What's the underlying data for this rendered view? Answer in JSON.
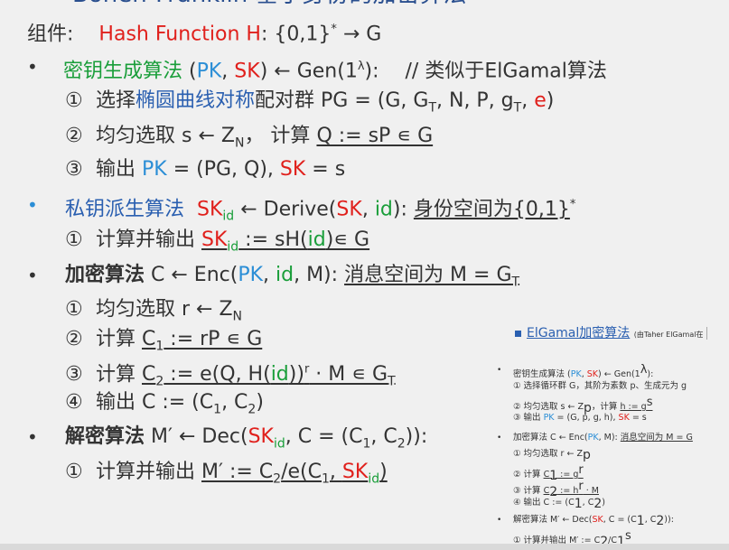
{
  "title_partial": "Boneh-Franklin 基于身份的加密算法",
  "components": {
    "label": "组件:",
    "hash": "Hash Function H",
    "rest": ": {0,1}",
    "star": "*",
    "arrow": " → G"
  },
  "keygen": {
    "name": "密钥生成算法",
    "pre": " (",
    "pk": "PK",
    "comma": ", ",
    "sk": "SK",
    "mid": ") ← Gen(1",
    "lambda": "λ",
    "post": "):",
    "comment": "// 类似于ElGamal算法",
    "s1_num": "①",
    "s1_a": "选择",
    "s1_b": "椭圆曲线对称",
    "s1_c": "配对群 PG = (G, G",
    "s1_t1": "T",
    "s1_d": ", N, P, g",
    "s1_t2": "T",
    "s1_e": ", ",
    "s1_ee": "e",
    "s1_f": ")",
    "s2_num": "②",
    "s2_a": "均匀选取 s ← Z",
    "s2_n": "N",
    "s2_b": "， 计算 ",
    "s2_c": "Q := sP ∊ G",
    "s3_num": "③",
    "s3_a": "输出 ",
    "s3_pk": "PK",
    "s3_b": " = (PG, Q), ",
    "s3_sk": "SK",
    "s3_c": " = s"
  },
  "derive": {
    "name": "私钥派生算法",
    "sk": "SK",
    "id": "id",
    "mid": " ← Derive(",
    "sk2": "SK",
    "comma": ", ",
    "id2": "id",
    "post": "):",
    "space": "身份空间为{0,1}",
    "star": "*",
    "s1_num": "①",
    "s1_a": "计算并输出 ",
    "s1_sk": "SK",
    "s1_id": "id",
    "s1_b": " := sH(",
    "s1_id2": "id",
    "s1_c": ")∊ G"
  },
  "enc": {
    "name": "加密算法",
    "pre": " C ← Enc(",
    "pk": "PK",
    "comma": ", ",
    "id": "id",
    "post": ", M):",
    "space": "消息空间为 M = G",
    "t": "T",
    "s1_num": "①",
    "s1_a": "均匀选取 r ← Z",
    "s1_n": "N",
    "s2_num": "②",
    "s2_a": "计算 ",
    "s2_c": "C",
    "s2_1": "1",
    "s2_b": " := rP ∊ G",
    "s3_num": "③",
    "s3_a": "计算 ",
    "s3_c": "C",
    "s3_2": "2",
    "s3_b": " := e(Q, H(",
    "s3_id": "id",
    "s3_d": "))",
    "s3_r": "r",
    "s3_e": " · M   ∊ G",
    "s3_t": "T",
    "s4_num": "④",
    "s4_a": "输出 C := (C",
    "s4_1": "1",
    "s4_b": ", C",
    "s4_2": "2",
    "s4_c": ")"
  },
  "dec": {
    "name": "解密算法",
    "pre": " M′ ← Dec(",
    "sk": "SK",
    "id": "id",
    "post": ", C = (C",
    "c1": "1",
    "mid": ", C",
    "c2": "2",
    "end": ")):",
    "s1_num": "①",
    "s1_a": "计算并输出 ",
    "s1_b": "M′ := C",
    "s1_2": "2",
    "s1_c": "/e(C",
    "s1_1": "1",
    "s1_d": ", ",
    "s1_sk": "SK",
    "s1_id": "id",
    "s1_e": ")"
  },
  "inset": {
    "title": "ElGamal加密算法",
    "note": "(由Taher ElGamal在",
    "kg": "密钥生成算法",
    "kg_pre": " (",
    "kg_pk": "PK",
    "kg_c": ", ",
    "kg_sk": "SK",
    "kg_post": ") ← Gen(1",
    "kg_l": "λ",
    "kg_end": "):",
    "kg1": "① 选择循环群 G，其阶为素数 p、生成元为 g",
    "kg2a": "② 均匀选取 s ← Z",
    "kg2p": "p",
    "kg2b": "，计算 ",
    "kg2c": "h := g",
    "kg2s": "s",
    "kg3a": "③ 输出 ",
    "kg3pk": "PK",
    "kg3b": " = (G, p, g, h), ",
    "kg3sk": "SK",
    "kg3c": " = s",
    "enc": "加密算法",
    "enc_pre": " C ← Enc(",
    "enc_pk": "PK",
    "enc_post": ", M):",
    "enc_space": "消息空间为 M = G",
    "e1a": "① 均匀选取 r ← Z",
    "e1p": "p",
    "e2a": "② 计算 ",
    "e2b": "C",
    "e2c": "1",
    "e2d": " := g",
    "e2e": "r",
    "e3a": "③ 计算 ",
    "e3b": "C",
    "e3c": "2",
    "e3d": " := h",
    "e3e": "r",
    "e3f": " · M",
    "e4a": "④ 输出 C := (C",
    "e4b": "1",
    "e4c": ", C",
    "e4d": "2",
    "e4e": ")",
    "dec": "解密算法",
    "dec_pre": " M′ ← Dec(",
    "dec_sk": "SK",
    "dec_post": ", C = (C",
    "dec_1": "1",
    "dec_m": ", C",
    "dec_2": "2",
    "dec_end": ")):",
    "d1a": "① 计算并输出 ",
    "d1b": "M′ := C",
    "d1c": "2",
    "d1d": "/C",
    "d1e": "1",
    "d1f": "s"
  },
  "bullet_glyph": "•"
}
